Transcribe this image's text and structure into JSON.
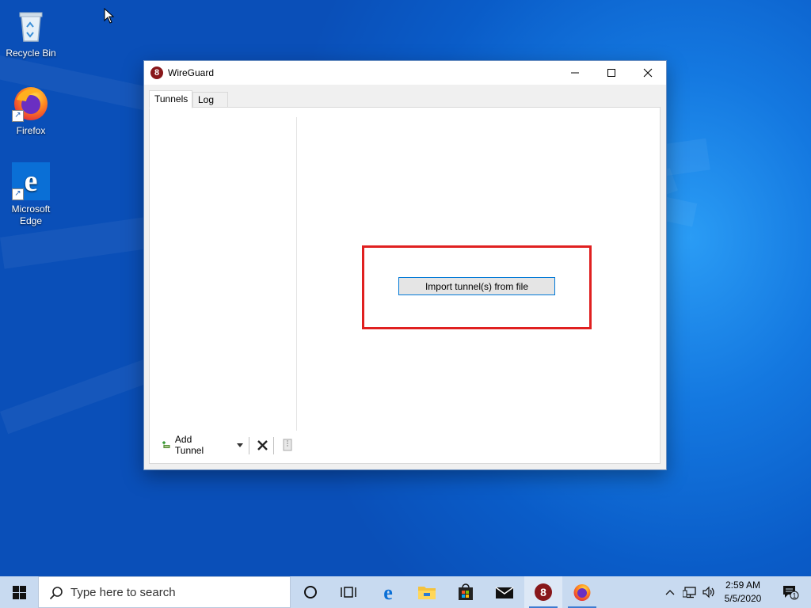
{
  "desktop": {
    "icons": [
      {
        "label": "Recycle Bin",
        "icon": "recycle-bin-icon"
      },
      {
        "label": "Firefox",
        "icon": "firefox-icon"
      },
      {
        "label": "Microsoft Edge",
        "icon": "edge-icon"
      }
    ]
  },
  "window": {
    "title": "WireGuard",
    "app_icon": "wireguard-icon",
    "controls": {
      "minimize": "minimize-icon",
      "maximize": "maximize-icon",
      "close": "close-icon"
    },
    "tabs": [
      {
        "label": "Tunnels",
        "active": true
      },
      {
        "label": "Log",
        "active": false
      }
    ],
    "import_button_label": "Import tunnel(s) from file",
    "highlight_color": "#e02020",
    "toolbar": {
      "add_tunnel_label": "Add Tunnel",
      "add_icon": "add-tunnel-icon",
      "dropdown_icon": "dropdown-arrow-icon",
      "delete_icon": "delete-icon",
      "export_icon": "export-zip-icon"
    }
  },
  "taskbar": {
    "search_placeholder": "Type here to search",
    "pinned": [
      {
        "name": "cortana-icon"
      },
      {
        "name": "task-view-icon"
      },
      {
        "name": "edge-icon"
      },
      {
        "name": "file-explorer-icon"
      },
      {
        "name": "store-icon"
      },
      {
        "name": "mail-icon"
      },
      {
        "name": "wireguard-icon",
        "active": true
      },
      {
        "name": "firefox-icon",
        "running": true
      }
    ],
    "tray": {
      "chevron": "show-hidden-icons",
      "network": "network-icon",
      "volume": "volume-icon",
      "notifications_count": "1"
    },
    "clock": {
      "time": "2:59 AM",
      "date": "5/5/2020"
    }
  },
  "colors": {
    "accent": "#0078d7",
    "wireguard_red": "#88171a",
    "desktop_blue": "#0a5cc8"
  }
}
